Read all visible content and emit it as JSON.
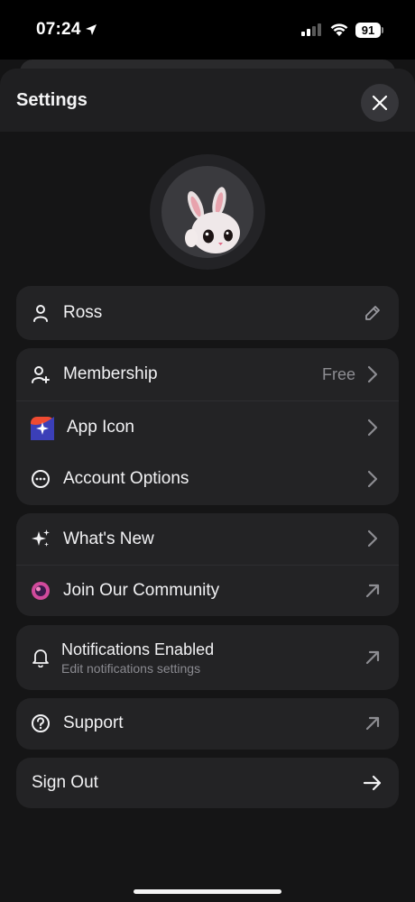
{
  "status_bar": {
    "time": "07:24",
    "battery": "91"
  },
  "header": {
    "title": "Settings"
  },
  "profile": {
    "name": "Ross"
  },
  "menu": {
    "membership": {
      "label": "Membership",
      "value": "Free"
    },
    "app_icon": {
      "label": "App Icon"
    },
    "account_options": {
      "label": "Account Options"
    },
    "whats_new": {
      "label": "What's New"
    },
    "community": {
      "label": "Join Our Community"
    },
    "notifications": {
      "label": "Notifications Enabled",
      "subtitle": "Edit notifications settings"
    },
    "support": {
      "label": "Support"
    },
    "sign_out": {
      "label": "Sign Out"
    }
  },
  "icons": {
    "edit": "pencil-icon",
    "chevron": "chevron-right-icon",
    "external": "arrow-up-right-icon",
    "sign_out": "arrow-right-icon"
  },
  "colors": {
    "background": "#151516",
    "card": "#232325",
    "accent_app_icon": "#e0462f",
    "community_accent": "#d24a9c"
  }
}
